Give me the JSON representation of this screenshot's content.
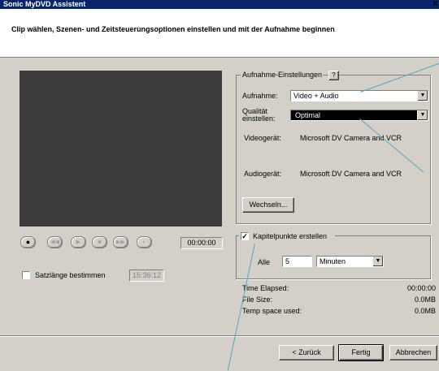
{
  "window": {
    "title": "Sonic MyDVD Assistent",
    "close_label": "x"
  },
  "header": {
    "instruction": "Clip wählen, Szenen- und Zeitsteuerungsoptionen einstellen und mit der Aufnahme beginnen"
  },
  "transport": {
    "time": "00:00:00"
  },
  "satzlaenge": {
    "label": "Satzlänge bestimmen",
    "value": "15:36:12",
    "checked": false
  },
  "aufnahme_settings": {
    "group_label": "Aufnahme-Einstellungen",
    "help_label": "?",
    "aufnahme_label": "Aufnahme:",
    "aufnahme_value": "Video + Audio",
    "qualitaet_label_1": "Qualität",
    "qualitaet_label_2": "einstellen:",
    "qualitaet_value": "Optimal",
    "videogeraet_label": "Videogerät:",
    "videogeraet_value": "Microsoft DV Camera and VCR",
    "audiogeraet_label": "Audiogerät:",
    "audiogeraet_value": "Microsoft DV Camera and VCR",
    "wechseln_label": "Wechseln..."
  },
  "kapitel": {
    "checkbox_label": "Kapitelpunkte erstellen",
    "checked": true,
    "check_mark": "✓",
    "alle_label": "Alle",
    "alle_value": "5",
    "unit_value": "Minuten"
  },
  "stats": {
    "time_elapsed_label": "Time Elapsed:",
    "time_elapsed_value": "00:00:00",
    "file_size_label": "File Size:",
    "file_size_value": "0.0MB",
    "temp_space_label": "Temp space used:",
    "temp_space_value": "0.0MB"
  },
  "footer": {
    "back_label": "< Zurück",
    "finish_label": "Fertig",
    "cancel_label": "Abbrechen"
  },
  "colors": {
    "title_bar": "#0a246a",
    "face": "#d4d0c8",
    "preview": "#3c3c3c",
    "pointer_line": "#4aa8c8"
  },
  "icons": {
    "record": "record-icon",
    "rewind": "rewind-icon",
    "play": "play-icon",
    "stop": "stop-icon",
    "fast_forward": "fast-forward-icon",
    "step": "step-icon",
    "dropdown": "chevron-down-icon"
  }
}
